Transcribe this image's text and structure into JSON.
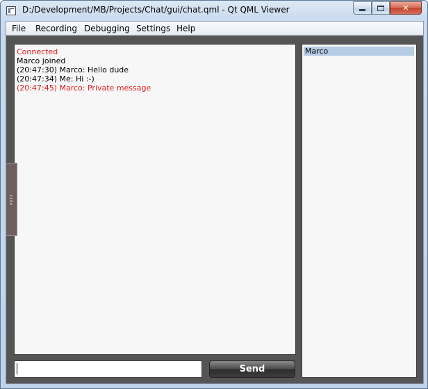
{
  "window": {
    "title": "D:/Development/MB/Projects/Chat/gui/chat.qml - Qt QML Viewer",
    "controls": {
      "minimize": "minimize",
      "maximize": "maximize",
      "close": "✕"
    }
  },
  "menubar": {
    "items": [
      {
        "label": "File"
      },
      {
        "label": "Recording"
      },
      {
        "label": "Debugging"
      },
      {
        "label": "Settings"
      },
      {
        "label": "Help"
      }
    ]
  },
  "chat": {
    "messages": [
      {
        "text": "Connected",
        "color": "#e01b1b"
      },
      {
        "text": "Marco joined",
        "color": "#000000"
      },
      {
        "text": "(20:47:30) Marco: Hello dude",
        "color": "#000000"
      },
      {
        "text": "(20:47:34) Me: Hi :-)",
        "color": "#000000"
      },
      {
        "text": "(20:47:45) Marco:  Private message",
        "color": "#e01b1b"
      }
    ]
  },
  "users": {
    "items": [
      {
        "name": "Marco",
        "selected": true
      }
    ]
  },
  "composer": {
    "input_value": "",
    "send_label": "Send"
  },
  "colors": {
    "background": "#555555",
    "panel": "#f7f7f7",
    "selection": "#b6cbe4",
    "accent_red": "#e01b1b"
  }
}
